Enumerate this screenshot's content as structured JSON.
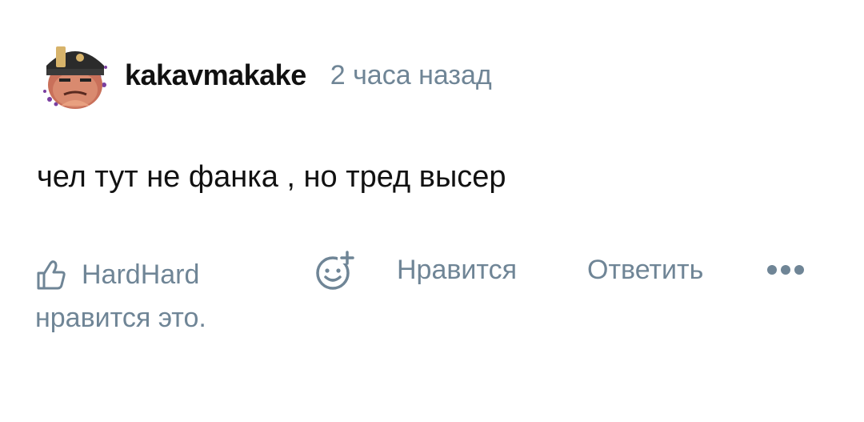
{
  "comment": {
    "author": {
      "username": "kakavmakake",
      "avatar": "avatar-image"
    },
    "timestamp": "2 часа назад",
    "text": "чел тут не фанка , но тред высер",
    "likes": {
      "icon": "thumbs-up-icon",
      "liker": "HardHard",
      "suffix": "нравится это."
    },
    "actions": {
      "reaction_icon": "add-reaction-icon",
      "like_label": "Нравится",
      "reply_label": "Ответить",
      "more_icon": "more-dots-icon"
    }
  },
  "colors": {
    "secondary_text": "#6f8596",
    "primary_text": "#111111",
    "background": "#ffffff"
  }
}
